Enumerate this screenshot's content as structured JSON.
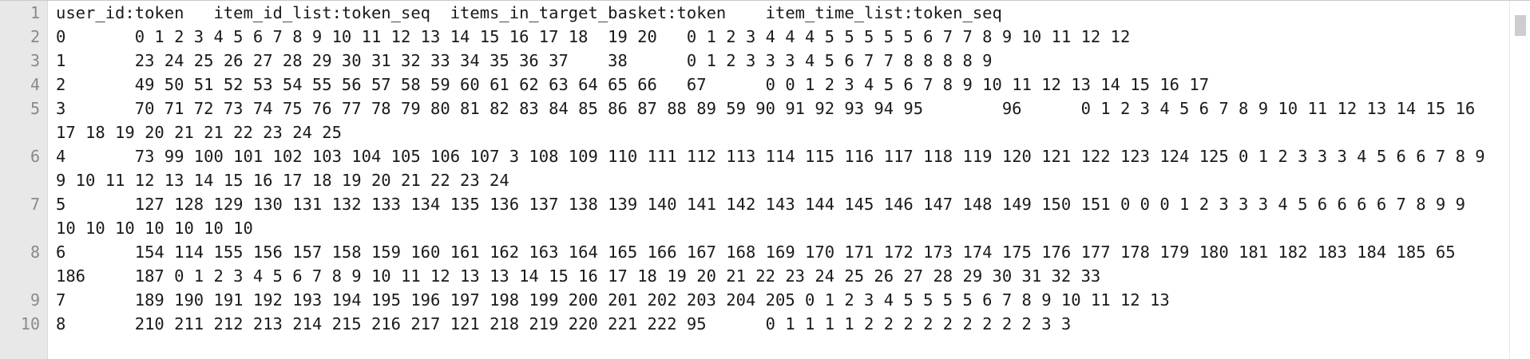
{
  "lines": [
    {
      "num": "1",
      "text": "user_id:token\titem_id_list:token_seq\titems_in_target_basket:token\titem_time_list:token_seq"
    },
    {
      "num": "2",
      "text": "0\t0 1 2 3 4 5 6 7 8 9 10 11 12 13 14 15 16 17 18\t19 20\t0 1 2 3 4 4 4 5 5 5 5 5 6 7 7 8 9 10 11 12 12"
    },
    {
      "num": "3",
      "text": "1\t23 24 25 26 27 28 29 30 31 32 33 34 35 36 37\t38\t0 1 2 3 3 3 4 5 6 7 7 8 8 8 8 9"
    },
    {
      "num": "4",
      "text": "2\t49 50 51 52 53 54 55 56 57 58 59 60 61 62 63 64 65 66\t67\t0 0 1 2 3 4 5 6 7 8 9 10 11 12 13 14 15 16 17"
    },
    {
      "num": "5",
      "text": "3\t70 71 72 73 74 75 76 77 78 79 80 81 82 83 84 85 86 87 88 89 59 90 91 92 93 94 95\t96\t0 1 2 3 4 5 6 7 8 9 10 11 12 13 14 15 16 17 18 19 20 21 21 22 23 24 25"
    },
    {
      "num": "6",
      "text": "4\t73 99 100 101 102 103 104 105 106 107 3 108 109 110 111 112 113 114 115 116 117 118 119 120 121 122 123 124 125 0 1 2 3 3 3 4 5 6 6 7 8 9 9 10 11 12 13 14 15 16 17 18 19 20 21 22 23 24"
    },
    {
      "num": "7",
      "text": "5\t127 128 129 130 131 132 133 134 135 136 137 138 139 140 141 142 143 144 145 146 147 148 149 150 151 0 0 0 1 2 3 3 3 4 5 6 6 6 6 7 8 9 9 10 10 10 10 10 10 10"
    },
    {
      "num": "8",
      "text": "6\t154 114 155 156 157 158 159 160 161 162 163 164 165 166 167 168 169 170 171 172 173 174 175 176 177 178 179 180 181 182 183 184 185 65 186\t187 0 1 2 3 4 5 6 7 8 9 10 11 12 13 13 14 15 16 17 18 19 20 21 22 23 24 25 26 27 28 29 30 31 32 33"
    },
    {
      "num": "9",
      "text": "7\t189 190 191 192 193 194 195 196 197 198 199 200 201 202 203 204 205 0 1 2 3 4 5 5 5 5 6 7 8 9 10 11 12 13"
    },
    {
      "num": "10",
      "text": "8\t210 211 212 213 214 215 216 217 121 218 219 220 221 222 95\t0 1 1 1 1 2 2 2 2 2 2 2 2 2 3 3"
    }
  ]
}
